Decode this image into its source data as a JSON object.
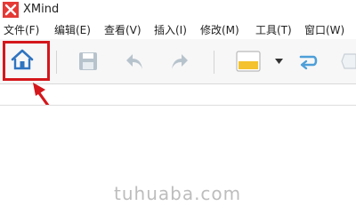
{
  "app": {
    "title": "XMind"
  },
  "menu": {
    "items": [
      {
        "label": "文件(F)"
      },
      {
        "label": "编辑(E)"
      },
      {
        "label": "查看(V)"
      },
      {
        "label": "插入(I)"
      },
      {
        "label": "修改(M)"
      },
      {
        "label": "工具(T)"
      },
      {
        "label": "窗口(W)"
      }
    ]
  },
  "toolbar": {
    "icons": [
      "home-icon",
      "save-icon",
      "undo-icon",
      "redo-icon",
      "style-icon",
      "dropdown-arrow-icon",
      "relationship-icon",
      "boundary-icon"
    ]
  },
  "annotation": {
    "color": "#d4171c"
  },
  "watermark": {
    "text": "tuhuaba.com"
  },
  "colors": {
    "accent_red": "#d4171c",
    "icon_blue": "#2f74c0",
    "icon_gray": "#b7c3cc",
    "style_yellow": "#f3c22e"
  }
}
